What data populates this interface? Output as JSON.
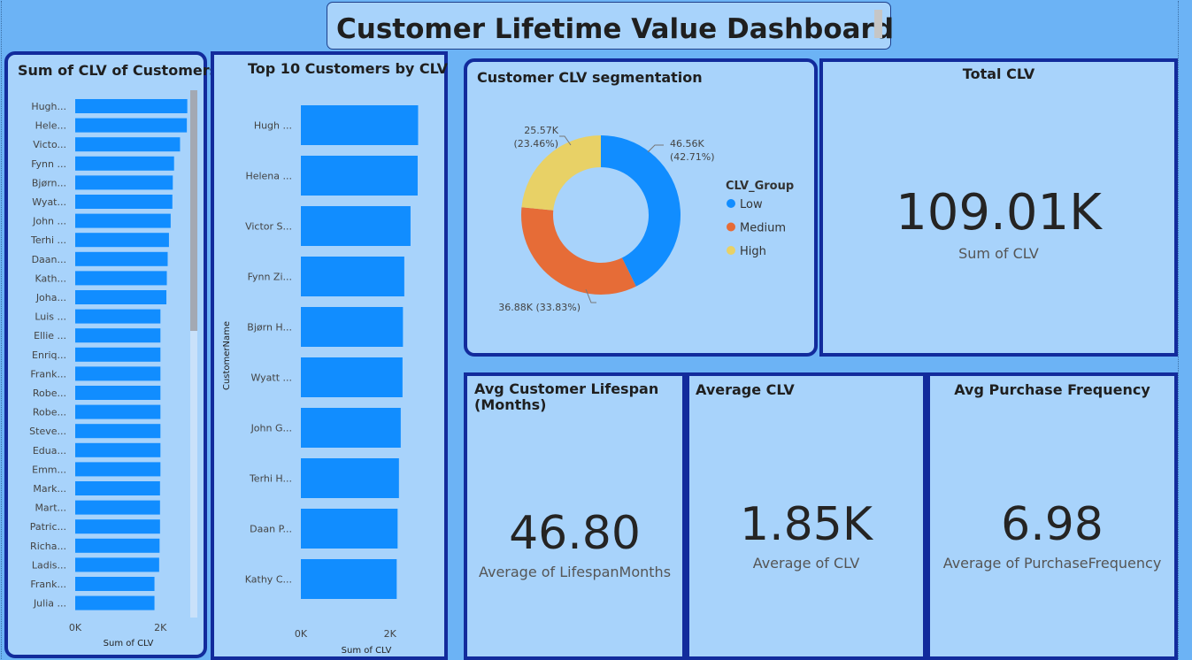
{
  "dashboard": {
    "title": "Customer Lifetime Value Dashboard"
  },
  "colors": {
    "background": "#6cb3f5",
    "panel": "#a8d3fb",
    "panel_border": "#122b9c",
    "bar": "#118dff",
    "low": "#118dff",
    "medium": "#e66c37",
    "high": "#e8d166"
  },
  "chart_data": [
    {
      "type": "bar",
      "orientation": "horizontal",
      "title": "Sum of CLV of Customers",
      "xlabel": "Sum of CLV",
      "ylabel": "",
      "xlim": [
        0,
        2700
      ],
      "x_ticks": [
        "0K",
        "2K"
      ],
      "categories": [
        "Hugh...",
        "Hele...",
        "Victo...",
        "Fynn ...",
        "Bjørn...",
        "Wyat...",
        "John ...",
        "Terhi ...",
        "Daan...",
        "Kath...",
        "Joha...",
        "Luis ...",
        "Ellie ...",
        "Enriq...",
        "Frank...",
        "Robe...",
        "Robe...",
        "Steve...",
        "Edua...",
        "Emm...",
        "Mark...",
        "Mart...",
        "Patric...",
        "Richa...",
        "Ladis...",
        "Frank...",
        "Julia ..."
      ],
      "values": [
        2630,
        2620,
        2460,
        2320,
        2290,
        2280,
        2240,
        2200,
        2170,
        2150,
        2140,
        2000,
        2000,
        2000,
        2000,
        2000,
        2000,
        2000,
        2000,
        2000,
        1990,
        1990,
        1990,
        1980,
        1970,
        1860,
        1860
      ],
      "scrollbar": true
    },
    {
      "type": "bar",
      "orientation": "horizontal",
      "title": "Top 10 Customers by CLV",
      "xlabel": "Sum of CLV",
      "ylabel": "CustomerName",
      "xlim": [
        0,
        2700
      ],
      "x_ticks": [
        "0K",
        "2K"
      ],
      "categories": [
        "Hugh ...",
        "Helena ...",
        "Victor S...",
        "Fynn Zi...",
        "Bjørn H...",
        "Wyatt ...",
        "John G...",
        "Terhi H...",
        "Daan P...",
        "Kathy C..."
      ],
      "values": [
        2630,
        2620,
        2460,
        2320,
        2290,
        2280,
        2240,
        2200,
        2170,
        2150
      ]
    },
    {
      "type": "pie",
      "style": "donut",
      "title": "Customer CLV segmentation",
      "legend_title": "CLV_Group",
      "legend_position": "right",
      "slices": [
        {
          "name": "Low",
          "value": 46.56,
          "label": "46.56K",
          "pct_label": "(42.71%)",
          "color": "#118dff"
        },
        {
          "name": "Medium",
          "value": 36.88,
          "label": "36.88K (33.83%)",
          "pct_label": "",
          "color": "#e66c37"
        },
        {
          "name": "High",
          "value": 25.57,
          "label": "25.57K",
          "pct_label": "(23.46%)",
          "color": "#e8d166"
        }
      ]
    }
  ],
  "cards": {
    "total_clv": {
      "title": "Total CLV",
      "value": "109.01K",
      "label": "Sum of CLV"
    },
    "lifespan": {
      "title_line1": "Avg Customer Lifespan",
      "title_line2": "(Months)",
      "value": "46.80",
      "label": "Average of LifespanMonths"
    },
    "avg_clv": {
      "title": "Average CLV",
      "value": "1.85K",
      "label": "Average of CLV"
    },
    "frequency": {
      "title": "Avg Purchase Frequency",
      "value": "6.98",
      "label": "Average of PurchaseFrequency"
    }
  }
}
